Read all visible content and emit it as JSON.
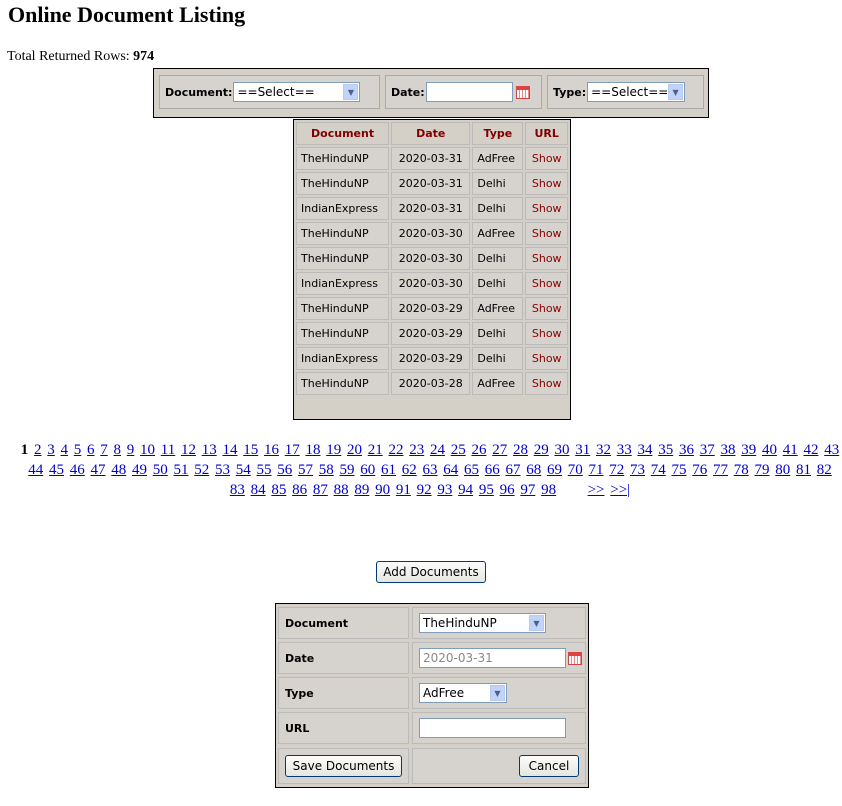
{
  "page": {
    "title": "Online Document Listing",
    "total_label": "Total Returned Rows:",
    "total_value": "974"
  },
  "filters": {
    "document_label": "Document:",
    "document_value": "==Select==",
    "date_label": "Date:",
    "date_value": "",
    "type_label": "Type:",
    "type_value": "==Select=="
  },
  "table": {
    "headers": [
      "Document",
      "Date",
      "Type",
      "URL"
    ],
    "rows": [
      {
        "document": "TheHinduNP",
        "date": "2020-03-31",
        "type": "AdFree",
        "url": "Show"
      },
      {
        "document": "TheHinduNP",
        "date": "2020-03-31",
        "type": "Delhi",
        "url": "Show"
      },
      {
        "document": "IndianExpress",
        "date": "2020-03-31",
        "type": "Delhi",
        "url": "Show"
      },
      {
        "document": "TheHinduNP",
        "date": "2020-03-30",
        "type": "AdFree",
        "url": "Show"
      },
      {
        "document": "TheHinduNP",
        "date": "2020-03-30",
        "type": "Delhi",
        "url": "Show"
      },
      {
        "document": "IndianExpress",
        "date": "2020-03-30",
        "type": "Delhi",
        "url": "Show"
      },
      {
        "document": "TheHinduNP",
        "date": "2020-03-29",
        "type": "AdFree",
        "url": "Show"
      },
      {
        "document": "TheHinduNP",
        "date": "2020-03-29",
        "type": "Delhi",
        "url": "Show"
      },
      {
        "document": "IndianExpress",
        "date": "2020-03-29",
        "type": "Delhi",
        "url": "Show"
      },
      {
        "document": "TheHinduNP",
        "date": "2020-03-28",
        "type": "AdFree",
        "url": "Show"
      }
    ]
  },
  "pager": {
    "current": "1",
    "first_page": 2,
    "last_page": 98,
    "next_label": ">>",
    "last_label": ">>|"
  },
  "actions": {
    "add_label": "Add Documents"
  },
  "form": {
    "document_label": "Document",
    "document_value": "TheHinduNP",
    "date_label": "Date",
    "date_value": "2020-03-31",
    "type_label": "Type",
    "type_value": "AdFree",
    "url_label": "URL",
    "url_value": "",
    "save_label": "Save Documents",
    "cancel_label": "Cancel"
  },
  "colors": {
    "header_text": "#800000",
    "link": "#0000cc",
    "panel": "#d4d0c8"
  }
}
